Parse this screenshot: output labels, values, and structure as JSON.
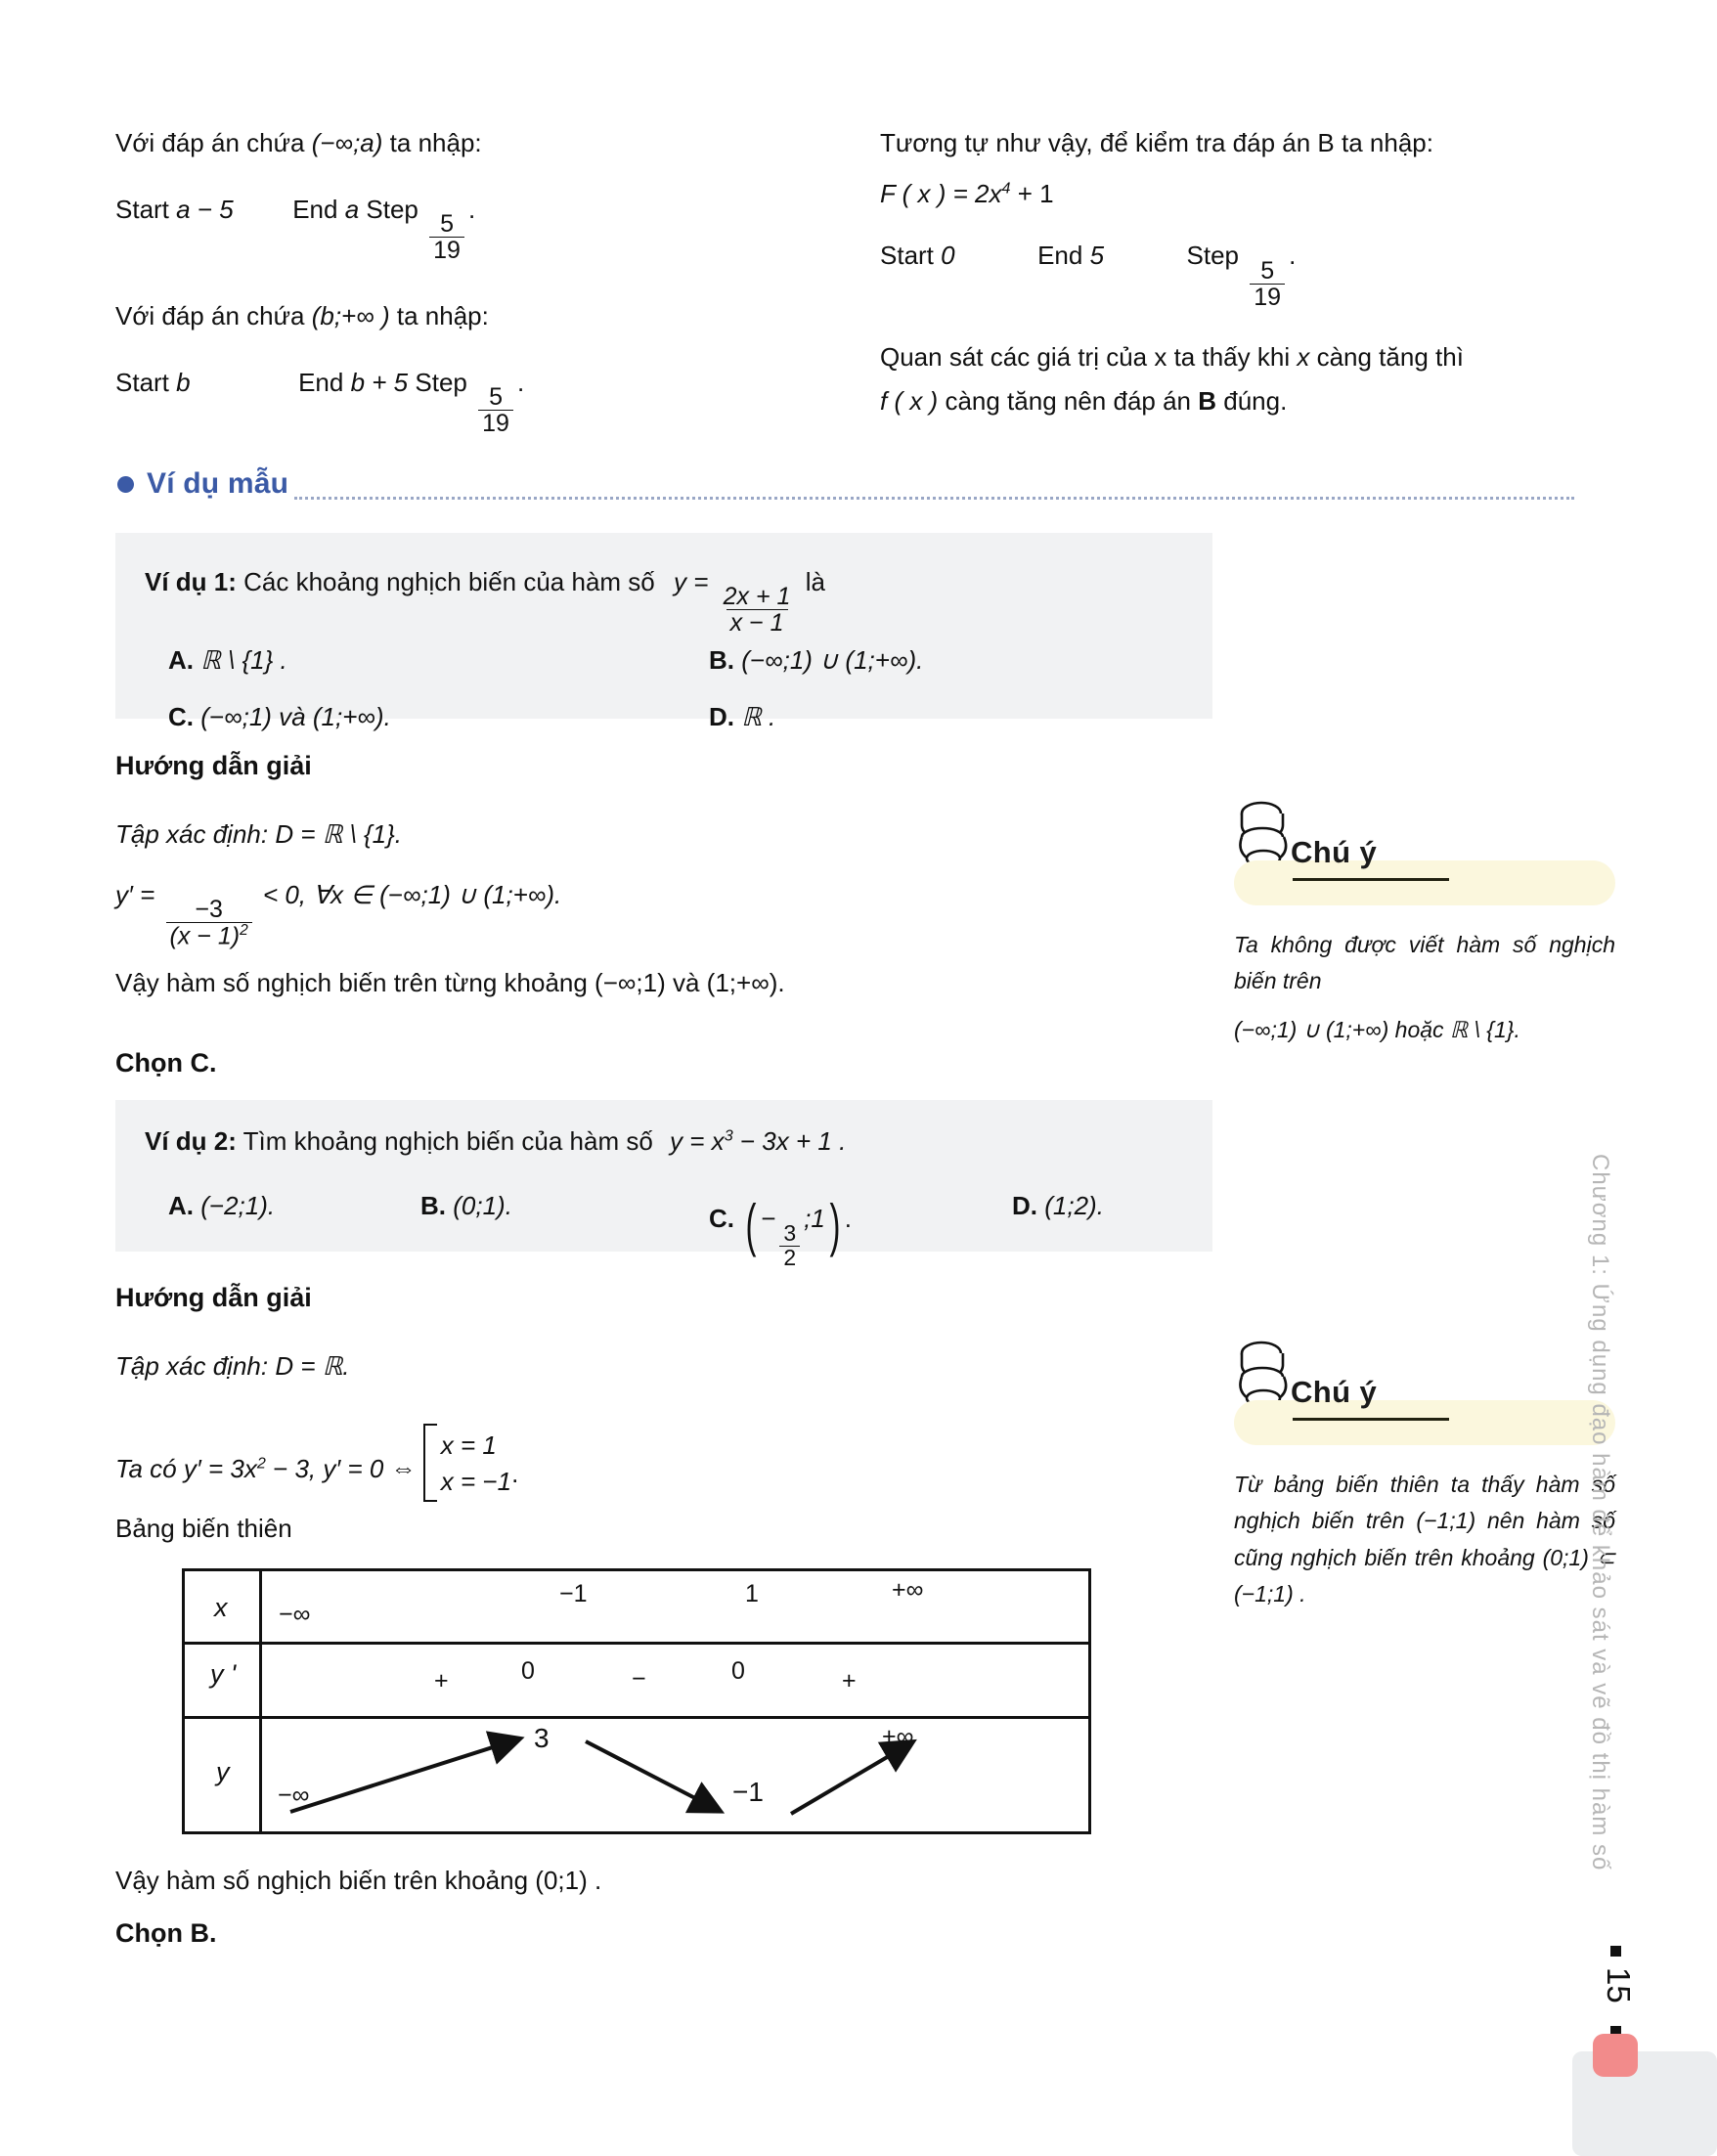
{
  "top_left": {
    "line1_pre": "Với đáp án chứa",
    "line1_interval": "(−∞;a)",
    "line1_post": "ta nhập:",
    "line2_start_label": "Start",
    "line2_start_value": "a − 5",
    "line2_end_label": "End",
    "line2_end_value": "a",
    "line2_step_label": "Step",
    "line2_step_num": "5",
    "line2_step_den": "19",
    "line3_pre": "Với đáp án chứa",
    "line3_interval": "(b;+∞ )",
    "line3_post": "ta nhập:",
    "line4_start_label": "Start",
    "line4_start_value": "b",
    "line4_end_label": "End",
    "line4_end_value": "b + 5",
    "line4_step_label": "Step",
    "line4_step_num": "5",
    "line4_step_den": "19"
  },
  "top_right": {
    "line1": "Tương tự như vậy, để kiểm tra đáp án B ta nhập:",
    "formula_lhs": "F ( x ) = 2x",
    "formula_exp": "4",
    "formula_tail": "+ 1",
    "start_label": "Start",
    "start_value": "0",
    "end_label": "End",
    "end_value": "5",
    "step_label": "Step",
    "step_num": "5",
    "step_den": "19",
    "line3a": "Quan sát các giá trị của x ta thấy khi",
    "line3b": "x",
    "line3c": "càng tăng thì",
    "line4a": "f ( x )",
    "line4b": "càng tăng nên đáp án",
    "line4c": "B",
    "line4d": "đúng."
  },
  "section": {
    "title": "Ví dụ mẫu",
    "accent_color": "#3b5aa6"
  },
  "example1": {
    "label": "Ví dụ 1:",
    "question_text": "Các khoảng nghịch biến của hàm số",
    "fn_y": "y =",
    "fn_num": "2x + 1",
    "fn_den": "x − 1",
    "question_tail": "là",
    "options": [
      {
        "key": "A.",
        "text": "ℝ \\ {1} ."
      },
      {
        "key": "B.",
        "text": "(−∞;1) ∪ (1;+∞)."
      },
      {
        "key": "C.",
        "text": "(−∞;1) và (1;+∞)."
      },
      {
        "key": "D.",
        "text": "ℝ ."
      }
    ],
    "solution_heading": "Hướng dẫn giải",
    "domain_line": "Tập xác định:  D = ℝ \\ {1}.",
    "deriv_prefix": "y′ =",
    "deriv_num": "−3",
    "deriv_den": "(x − 1)",
    "deriv_den_exp": "2",
    "deriv_tail": "< 0, ∀x ∈ (−∞;1) ∪ (1;+∞).",
    "conclusion": "Vậy hàm số nghịch biến trên từng khoảng (−∞;1) và (1;+∞).",
    "choice": "Chọn C."
  },
  "note1": {
    "title": "Chú ý",
    "line1": "Ta không được viết hàm số nghịch biến trên",
    "line2": "(−∞;1) ∪ (1;+∞) hoặc ℝ \\ {1}.",
    "banner_color": "#fbf7dd"
  },
  "example2": {
    "label": "Ví dụ 2:",
    "question_text": "Tìm khoảng nghịch biến của hàm số",
    "fn": "y = x",
    "fn_exp": "3",
    "fn_tail": "− 3x + 1 .",
    "options": [
      {
        "key": "A.",
        "text": "(−2;1)."
      },
      {
        "key": "B.",
        "text": "(0;1)."
      },
      {
        "key": "C.",
        "num": "3",
        "den": "2",
        "pre": "(−",
        "post": ";1)."
      },
      {
        "key": "D.",
        "text": "(1;2)."
      }
    ],
    "solution_heading": "Hướng dẫn giải",
    "domain_line": "Tập xác định:  D = ℝ.",
    "deriv_line_a": "Ta có  y′ = 3x",
    "deriv_exp": "2",
    "deriv_line_b": "− 3,  y′ = 0 ⇔",
    "case1": "x = 1",
    "case2": "x = −1",
    "case_dot": ".",
    "table_caption": "Bảng biến thiên",
    "conclusion": "Vậy hàm số nghịch biến trên khoảng (0;1) .",
    "choice": "Chọn B."
  },
  "note2": {
    "title": "Chú ý",
    "line1": "Từ bảng biến thiên ta thấy hàm số nghịch biến trên",
    "line2": "(−1;1)",
    "line3": "nên hàm số cũng nghịch biến trên khoảng",
    "line4": "(0;1) ⊂ (−1;1) ."
  },
  "chart_data": {
    "type": "table",
    "title": "Bảng biến thiên",
    "row_labels": [
      "x",
      "y '",
      "y"
    ],
    "x_ticks": [
      "−∞",
      "−1",
      "1",
      "+∞"
    ],
    "yprime_signs": [
      "+",
      "0",
      "−",
      "0",
      "+"
    ],
    "y_values": [
      "−∞",
      "3",
      "−1",
      "+∞"
    ],
    "monotonic": [
      "increasing",
      "decreasing",
      "increasing"
    ]
  },
  "furniture": {
    "side_text": "Chương 1: Ứng dụng đạo hàm để khảo sát và vẽ đồ thị hàm số",
    "page_number": "15",
    "accent_pink": "#f28b8b",
    "footer_gray": "#ebedef"
  }
}
